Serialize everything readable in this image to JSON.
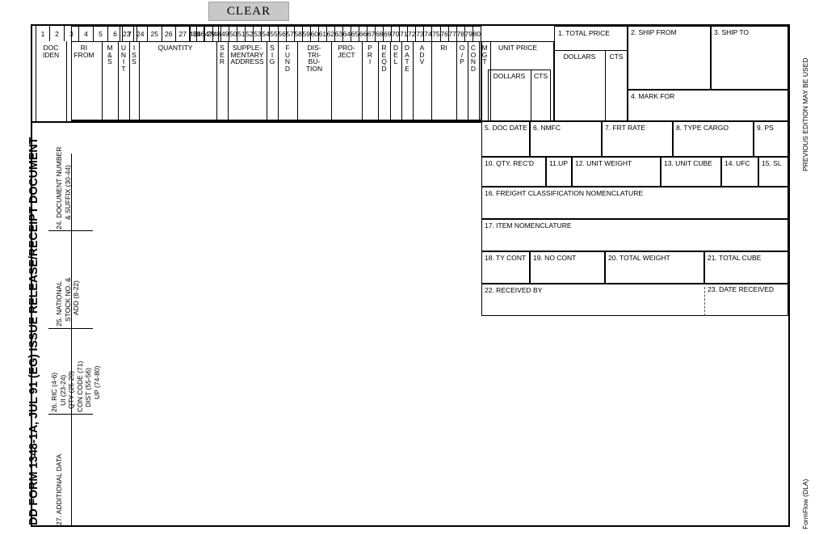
{
  "toolbar": {
    "clear_label": "CLEAR"
  },
  "form": {
    "spine_title": "DD FORM 1348-1A, JUL 91 (EG)  ISSUE RELEASE/RECEIPT DOCUMENT",
    "right_note": "PREVIOUS EDITION MAY BE USED",
    "footer_note": "FormFlow (DLA)"
  },
  "card_columns": {
    "row1": [
      "1",
      "2",
      "3",
      "4",
      "5",
      "6",
      "7"
    ],
    "row2": [
      "23",
      "24",
      "25",
      "26",
      "27",
      "28",
      "29"
    ],
    "row3": [
      "45",
      "46",
      "47",
      "48",
      "49",
      "50",
      "51",
      "52",
      "53",
      "54",
      "55",
      "56",
      "57",
      "58",
      "59",
      "60",
      "61",
      "62",
      "63",
      "64",
      "65",
      "66",
      "67",
      "68",
      "69",
      "70",
      "71",
      "72",
      "73",
      "74",
      "75",
      "76",
      "77",
      "78",
      "79",
      "80"
    ]
  },
  "card_fields": [
    {
      "name": "doc-iden",
      "label": "DOC IDEN",
      "lines": [
        "DOC",
        "IDEN"
      ]
    },
    {
      "name": "ri-from",
      "label": "RI FROM",
      "lines": [
        "RI",
        "FROM"
      ]
    },
    {
      "name": "m-and-s",
      "label": "M&S",
      "lines": [
        "M&S"
      ]
    },
    {
      "name": "unit",
      "label": "UNIT",
      "lines": [
        "UNIT"
      ]
    },
    {
      "name": "iss",
      "label": "ISS",
      "lines": [
        "ISS"
      ]
    },
    {
      "name": "quantity",
      "label": "QUANTITY",
      "lines": [
        "QUANTITY"
      ]
    },
    {
      "name": "ser",
      "label": "SER",
      "lines": [
        "SER"
      ]
    },
    {
      "name": "supplementary-address",
      "label": "SUPPLE- MENTARY ADDRESS",
      "lines": [
        "SUPPLE-",
        "MENTARY",
        "ADDRESS"
      ]
    },
    {
      "name": "sig",
      "label": "SIG",
      "lines": [
        "SIG"
      ]
    },
    {
      "name": "fund",
      "label": "FUND",
      "lines": [
        "FUND"
      ]
    },
    {
      "name": "distribution",
      "label": "DIS- TRI- BU- TION",
      "lines": [
        "DIS-",
        "TRI-",
        "BU-",
        "TION"
      ]
    },
    {
      "name": "project",
      "label": "PRO- JECT",
      "lines": [
        "PRO-",
        "JECT"
      ]
    },
    {
      "name": "pri",
      "label": "PRI",
      "lines": [
        "PRI"
      ]
    },
    {
      "name": "reqd",
      "label": "REQD",
      "lines": [
        "REQD"
      ]
    },
    {
      "name": "del",
      "label": "DEL",
      "lines": [
        "DEL"
      ]
    },
    {
      "name": "date",
      "label": "DATE",
      "lines": [
        "DATE"
      ]
    },
    {
      "name": "adv",
      "label": "ADV",
      "lines": [
        "ADV"
      ]
    },
    {
      "name": "ri",
      "label": "RI",
      "lines": [
        "RI"
      ]
    },
    {
      "name": "op",
      "label": "O/P",
      "lines": [
        "O/P"
      ]
    },
    {
      "name": "cond",
      "label": "COND",
      "lines": [
        "COND"
      ]
    },
    {
      "name": "mgt",
      "label": "MGT",
      "lines": [
        "MGT"
      ]
    }
  ],
  "unit_price": {
    "title": "UNIT PRICE",
    "dollars": "DOLLARS",
    "cts": "CTS"
  },
  "total_price": {
    "title": "1.  TOTAL PRICE",
    "dollars": "DOLLARS",
    "cts": "CTS"
  },
  "boxes": {
    "ship_from": "2. SHIP FROM",
    "ship_to": "3. SHIP TO",
    "mark_for": "4. MARK FOR",
    "doc_date": "5. DOC DATE",
    "nmfc": "6. NMFC",
    "frt_rate": "7. FRT RATE",
    "type_cargo": "8. TYPE CARGO",
    "ps": "9. PS",
    "qty_recd": "10. QTY. REC'D",
    "up": "11.UP",
    "unit_weight": "12. UNIT WEIGHT",
    "unit_cube": "13. UNIT CUBE",
    "ufc": "14. UFC",
    "sl": "15. SL",
    "freight_classification": "16. FREIGHT CLASSIFICATION NOMENCLATURE",
    "item_nomenclature": "17. ITEM NOMENCLATURE",
    "ty_cont": "18. TY CONT",
    "no_cont": "19. NO CONT",
    "total_weight": "20. TOTAL WEIGHT",
    "total_cube": "21. TOTAL CUBE",
    "received_by": "22. RECEIVED BY",
    "date_received": "23. DATE RECEIVED"
  },
  "left_sections": {
    "document_number": "24. DOCUMENT NUMBER & SUFFIX (30-44)",
    "document_number_l1": "24. DOCUMENT NUMBER",
    "document_number_l2": "& SUFFIX (30-44)",
    "national_stock": "25. NATIONAL STOCK NO. & ADD (8-22)",
    "national_stock_l1": "25. NATIONAL",
    "national_stock_l2": "STOCK NO. &",
    "national_stock_l3": "ADD (8-22)",
    "ric_block_l1": "26. RIC (4-6)",
    "ric_block_l2": "UI (23-24)",
    "ric_block_l3": "QTY (25-29)",
    "ric_block_l4": "CON CODE (71)",
    "ric_block_l5": "DIST (55-56)",
    "ric_block_l6": "UP (74-80)",
    "additional_data": "27. ADDITIONAL DATA"
  }
}
